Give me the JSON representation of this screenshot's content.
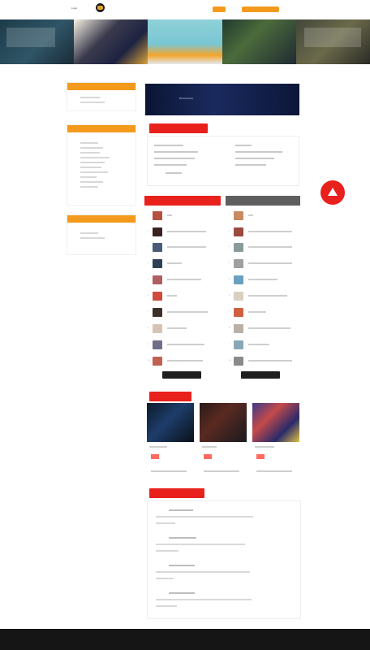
{
  "header": {
    "logo_text": "Logo",
    "links": [
      "",
      ""
    ],
    "button_1": "",
    "button_2": ""
  },
  "tabs": {
    "active": "",
    "others": [
      "",
      ""
    ]
  },
  "promo": {
    "text": "Promotion"
  },
  "sidebar": {
    "box1_title": "",
    "box2_title": "",
    "box3_title": ""
  },
  "sections": {
    "news_title": "",
    "rank_left_title": "",
    "rank_right_title": "",
    "video_title": "",
    "bottom_title": ""
  },
  "rank_left": [
    "",
    "",
    "",
    "",
    "",
    "",
    "",
    "",
    "",
    ""
  ],
  "rank_right": [
    "",
    "",
    "",
    "",
    "",
    "",
    "",
    "",
    "",
    ""
  ],
  "buttons": {
    "more_left": "",
    "more_right": ""
  },
  "footer": {
    "text": ""
  },
  "colors": {
    "accent_orange": "#f39a1c",
    "accent_red": "#e8211d",
    "footer_bg": "#151515"
  }
}
